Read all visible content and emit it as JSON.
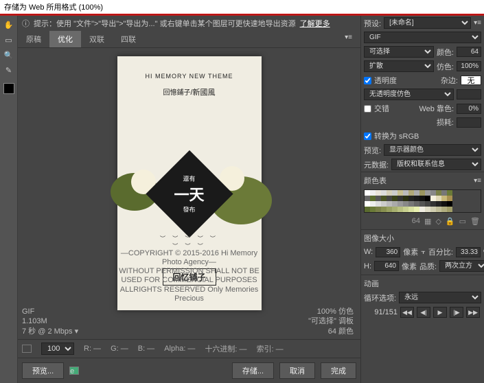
{
  "title": "存储为 Web 所用格式 (100%)",
  "hint": {
    "icon": "ⓘ",
    "prefix": "提示：使用",
    "path": "\"文件\">\"导出\">\"导出为...\"",
    "suffix": "或右键单击某个图层可更快速地导出资源",
    "more": "了解更多"
  },
  "tabs": [
    "原稿",
    "优化",
    "双联",
    "四联"
  ],
  "activeTab": 1,
  "artwork": {
    "subtitle": "HI MEMORY NEW THEME",
    "title_small": "回憶鋪子",
    "title_big": "/新國風",
    "diamond_top": "還有",
    "diamond_mid": "一天",
    "diamond_bot": "發布",
    "frame": "回忆铺子",
    "copy1": "—COPYRIGHT © 2015-2016 Hi Memory Photo Agency—",
    "copy2": "WITHOUT PERMISSION SHALL NOT BE USED FOR COMMERCIAL PURPOSES",
    "copy3": "ALLRIGHTS RESERVED Only Memories Precious"
  },
  "status": {
    "left1": "GIF",
    "left2": "1.103M",
    "left3": "7 秒 @ 2 Mbps  ▾",
    "right1": "100% 仿色",
    "right2": "\"可选择\" 调板",
    "right3": "64 颜色"
  },
  "footer1": {
    "zoom": "100%",
    "r": "R:  —",
    "g": "G:  —",
    "b": "B:  —",
    "alpha": "Alpha:  —",
    "hex": "十六进制:  —",
    "index": "索引:  —"
  },
  "footer2": {
    "preview": "预览...",
    "save": "存储...",
    "cancel": "取消",
    "done": "完成"
  },
  "panel": {
    "preset_label": "预设:",
    "preset_value": "[未命名]",
    "format": "GIF",
    "reduction": "可选择",
    "colors_label": "颜色:",
    "colors": "64",
    "dither": "扩散",
    "dither_label": "仿色:",
    "dither_val": "100%",
    "transparency": "透明度",
    "matte_label": "杂边:",
    "matte": "无",
    "trans_dither": "无透明度仿色",
    "trans_amt": "",
    "interlace": "交错",
    "websnap_label": "Web 靠色:",
    "websnap": "0%",
    "lossy_label": "损耗:",
    "lossy": "",
    "convert": "转换为 sRGB",
    "preview_label": "预览:",
    "preview_val": "显示器颜色",
    "meta_label": "元数据:",
    "meta_val": "版权和联系信息",
    "colortable": "颜色表",
    "ct_count": "64",
    "imagesize": "图像大小",
    "w": "W:",
    "w_val": "360",
    "h": "H:",
    "h_val": "640",
    "px": "像素",
    "pct_label": "百分比:",
    "pct": "33.33",
    "quality_label": "品质:",
    "quality": "两次立方（较平...",
    "anim": "动画",
    "loop_label": "循环选项:",
    "loop": "永远",
    "frame": "91/151"
  },
  "palette_colors": [
    "#fff",
    "#eee",
    "#e8e4d8",
    "#ddd",
    "#d5d0b8",
    "#ccc",
    "#c8c090",
    "#bbb",
    "#b0a878",
    "#aaa",
    "#9a9560",
    "#999",
    "#888",
    "#7a8048",
    "#777",
    "#6b7a38",
    "#666",
    "#5a6b2e",
    "#555",
    "#4a5424",
    "#444",
    "#3a4218",
    "#333",
    "#2a3010",
    "#222",
    "#1a1a1a",
    "#111",
    "#000",
    "#f5f0dc",
    "#e0d8b8",
    "#c8b878",
    "#a89050",
    "#fff",
    "#eee",
    "#ddd",
    "#ccc",
    "#bbb",
    "#aaa",
    "#999",
    "#888",
    "#777",
    "#666",
    "#555",
    "#444",
    "#333",
    "#222",
    "#111",
    "#000",
    "#5a6b2e",
    "#6b7a38",
    "#7a8048",
    "#889050",
    "#98a060",
    "#a8b070",
    "#b8c080",
    "#c8d090",
    "#d8e0a0",
    "#e8f0b0",
    "#f0ede2",
    "#e0ddc8",
    "#d0cdb0",
    "#c0bd98",
    "#b0ad80",
    "#a09d68"
  ]
}
